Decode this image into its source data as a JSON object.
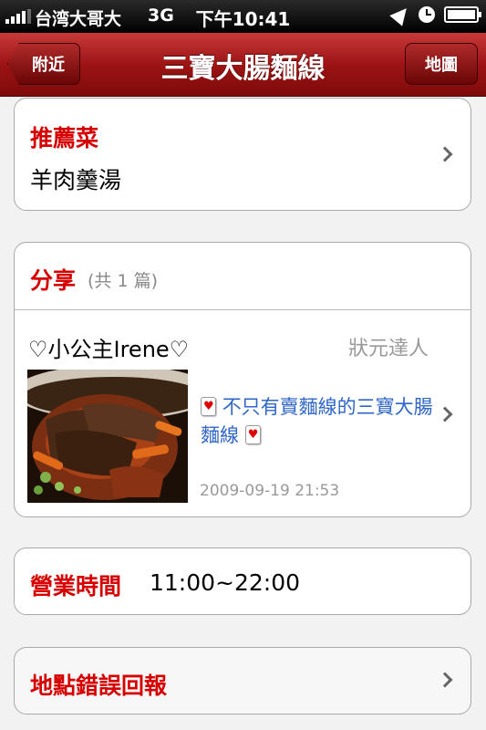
{
  "status_bar": {
    "carrier": "台湾大哥大",
    "network": "3G",
    "time": "下午10:41",
    "icons": [
      "signal-icon",
      "location-arrow-icon",
      "clock-icon",
      "battery-icon"
    ]
  },
  "nav": {
    "back_label": "附近",
    "title": "三寶大腸麵線",
    "map_label": "地圖"
  },
  "recommended": {
    "header": "推薦菜",
    "dish": "羊肉羹湯"
  },
  "share": {
    "header": "分享",
    "count_text": "(共 1 篇)",
    "post": {
      "author": "♡小公主Irene♡",
      "rank": "狀元達人",
      "title": "不只有賣麵線的三寶大腸麵線",
      "date": "2009-09-19 21:53"
    }
  },
  "hours": {
    "label": "營業時間",
    "value": "11:00~22:00"
  },
  "report": {
    "label": "地點錯誤回報"
  },
  "colors": {
    "accent_red": "#d60000",
    "nav_red": "#9d1414",
    "link_blue": "#2f66c8"
  }
}
